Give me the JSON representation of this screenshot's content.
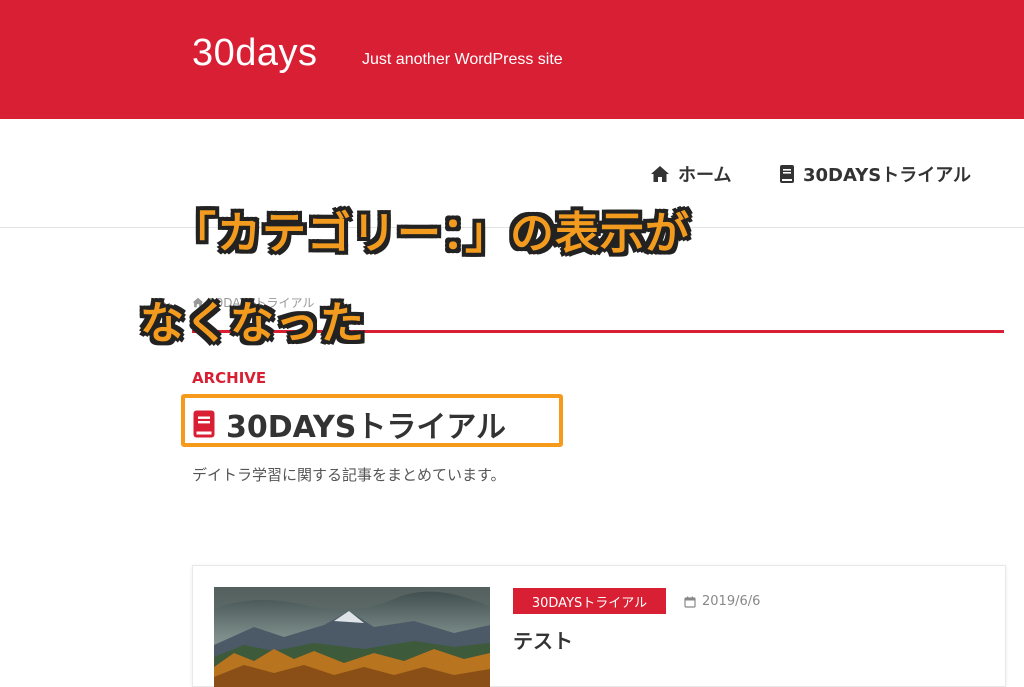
{
  "header": {
    "site_title": "30days",
    "tagline": "Just another WordPress site",
    "background": "#d81f33"
  },
  "nav": {
    "home_label": "ホーム",
    "home_icon": "home-icon",
    "trial_label": "30DAYSトライアル",
    "trial_icon": "book-icon"
  },
  "breadcrumb": {
    "home_icon": "home-icon",
    "current": "30DAYSトライアル"
  },
  "archive": {
    "label": "ARCHIVE",
    "title": "30DAYSトライアル",
    "title_icon": "book-icon",
    "description": "デイトラ学習に関する記事をまとめています。",
    "highlight_color": "#f59a1b"
  },
  "post": {
    "category": "30DAYSトライアル",
    "date": "2019/6/6",
    "date_icon": "calendar-icon",
    "title": "テスト"
  },
  "annotation": {
    "line1": "「カテゴリー：」の表示が",
    "line2": "なくなった",
    "color": "#f39b1e"
  }
}
